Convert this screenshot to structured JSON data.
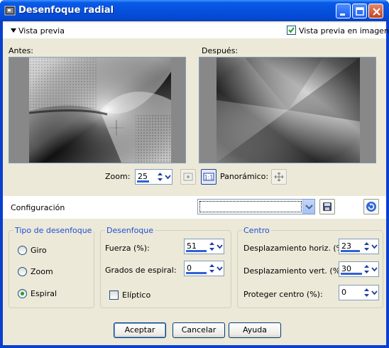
{
  "window": {
    "title": "Desenfoque radial",
    "controls": [
      "minimize",
      "maximize",
      "close"
    ]
  },
  "preview": {
    "toggle_label": "Vista previa",
    "in_image_label": "Vista previa en imagen",
    "in_image_checked": true,
    "before_label": "Antes:",
    "after_label": "Después:"
  },
  "zoom": {
    "label": "Zoom:",
    "value": "25",
    "panoramic_label": "Panorámico:"
  },
  "config": {
    "label": "Configuración",
    "preset_value": ""
  },
  "blur_type": {
    "title": "Tipo de desenfoque",
    "options": [
      {
        "label": "Giro",
        "selected": false
      },
      {
        "label": "Zoom",
        "selected": false
      },
      {
        "label": "Espiral",
        "selected": true
      }
    ]
  },
  "blur": {
    "title": "Desenfoque",
    "strength_label": "Fuerza (%):",
    "strength_value": "51",
    "spiral_label": "Grados de espiral:",
    "spiral_value": "0",
    "elliptic_label": "Elíptico",
    "elliptic_checked": false
  },
  "center": {
    "title": "Centro",
    "h_offset_label": "Desplazamiento horiz. (%):",
    "h_offset_value": "23",
    "v_offset_label": "Desplazamiento vert. (%):",
    "v_offset_value": "30",
    "protect_label": "Proteger centro (%):",
    "protect_value": "0"
  },
  "buttons": {
    "ok": "Aceptar",
    "cancel": "Cancelar",
    "help": "Ayuda"
  },
  "colors": {
    "accent": "#1f4fd5",
    "title_bar": "#0551dc",
    "dialog_bg": "#ece9d8",
    "check_green": "#21a121"
  }
}
